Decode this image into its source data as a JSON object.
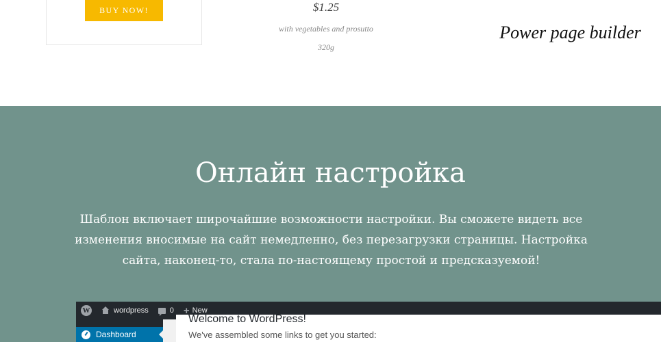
{
  "product_card": {
    "buy_button_label": "BUY NOW!"
  },
  "product": {
    "price": "$1.25",
    "description": "with vegetables and prosutto",
    "weight": "320g"
  },
  "caption": "Power page builder",
  "feature": {
    "title": "Онлайн настройка",
    "text": "Шаблон включает широчайшие возможности настройки. Вы сможете видеть все изменения вносимые на сайт немедленно, без перезагрузки страницы. Настройка сайта, наконец-то, стала по-настоящему простой и предсказуемой!",
    "background_color": "#71938c"
  },
  "wp_preview": {
    "admin_bar": {
      "logo_icon": "wordpress-logo-icon",
      "site_name": "wordpress",
      "comments_count": "0",
      "new_label": "New"
    },
    "sidebar": {
      "active_item": "Dashboard"
    },
    "welcome_title": "Welcome to WordPress!",
    "welcome_subtitle": "We've assembled some links to get you started:"
  },
  "colors": {
    "buy_button": "#f7b900",
    "admin_bar": "#23282d",
    "sidebar_active": "#0073aa"
  }
}
